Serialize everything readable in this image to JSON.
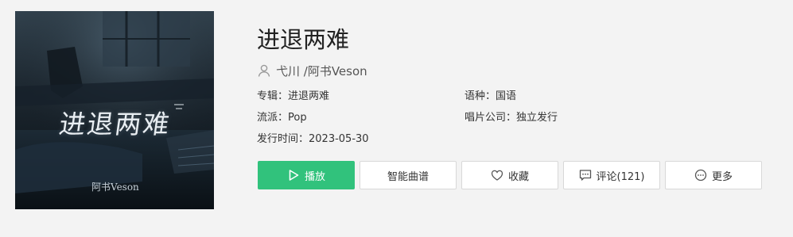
{
  "cover": {
    "title": "进退两难",
    "artist": "阿书Veson"
  },
  "song": {
    "title": "进退两难",
    "artists": "弋川 /阿书Veson"
  },
  "meta": {
    "album_label": "专辑：",
    "album_value": "进退两难",
    "genre_label": "流派：",
    "genre_value": "Pop",
    "release_label": "发行时间：",
    "release_value": "2023-05-30",
    "language_label": "语种：",
    "language_value": "国语",
    "company_label": "唱片公司：",
    "company_value": "独立发行"
  },
  "actions": {
    "play": "播放",
    "score": "智能曲谱",
    "favorite": "收藏",
    "comment": "评论(121)",
    "more": "更多"
  },
  "colors": {
    "accent": "#31c27c",
    "background": "#f3f3f3"
  },
  "icons": {
    "artist": "user-icon",
    "play": "play-icon",
    "favorite": "heart-icon",
    "comment": "comment-icon",
    "more": "more-icon"
  }
}
